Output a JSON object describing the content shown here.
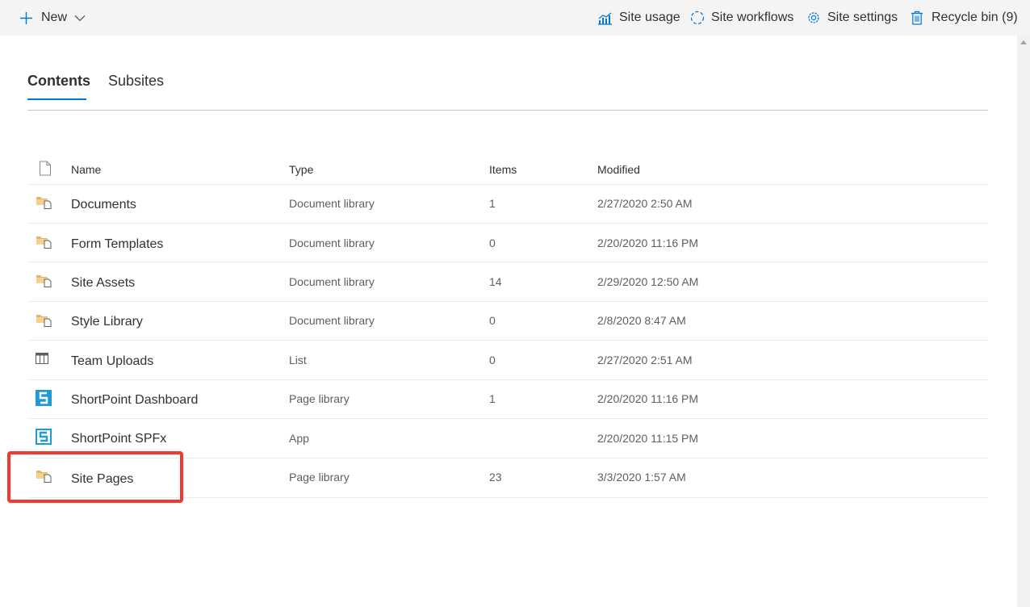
{
  "command_bar": {
    "new_label": "New",
    "site_usage_label": "Site usage",
    "site_workflows_label": "Site workflows",
    "site_settings_label": "Site settings",
    "recycle_bin_label": "Recycle bin (9)"
  },
  "tabs": [
    {
      "label": "Contents",
      "active": true
    },
    {
      "label": "Subsites",
      "active": false
    }
  ],
  "table": {
    "columns": {
      "name": "Name",
      "type": "Type",
      "items": "Items",
      "modified": "Modified"
    },
    "rows": [
      {
        "icon": "document-library-icon",
        "name": "Documents",
        "type": "Document library",
        "items": "1",
        "modified": "2/27/2020 2:50 AM"
      },
      {
        "icon": "document-library-icon",
        "name": "Form Templates",
        "type": "Document library",
        "items": "0",
        "modified": "2/20/2020 11:16 PM"
      },
      {
        "icon": "document-library-icon",
        "name": "Site Assets",
        "type": "Document library",
        "items": "14",
        "modified": "2/29/2020 12:50 AM"
      },
      {
        "icon": "document-library-icon",
        "name": "Style Library",
        "type": "Document library",
        "items": "0",
        "modified": "2/8/2020 8:47 AM"
      },
      {
        "icon": "list-icon",
        "name": "Team Uploads",
        "type": "List",
        "items": "0",
        "modified": "2/27/2020 2:51 AM"
      },
      {
        "icon": "shortpoint-icon",
        "name": "ShortPoint Dashboard",
        "type": "Page library",
        "items": "1",
        "modified": "2/20/2020 11:16 PM"
      },
      {
        "icon": "shortpoint-icon",
        "name": "ShortPoint SPFx",
        "type": "App",
        "items": "",
        "modified": "2/20/2020 11:15 PM"
      },
      {
        "icon": "document-library-icon",
        "name": "Site Pages",
        "type": "Page library",
        "items": "23",
        "modified": "3/3/2020 1:57 AM"
      }
    ]
  },
  "colors": {
    "accent": "#0078d4",
    "highlight": "#f03a2f",
    "library_icon": "#e8b26a",
    "shortpoint_icon": "#1e9bd7"
  }
}
